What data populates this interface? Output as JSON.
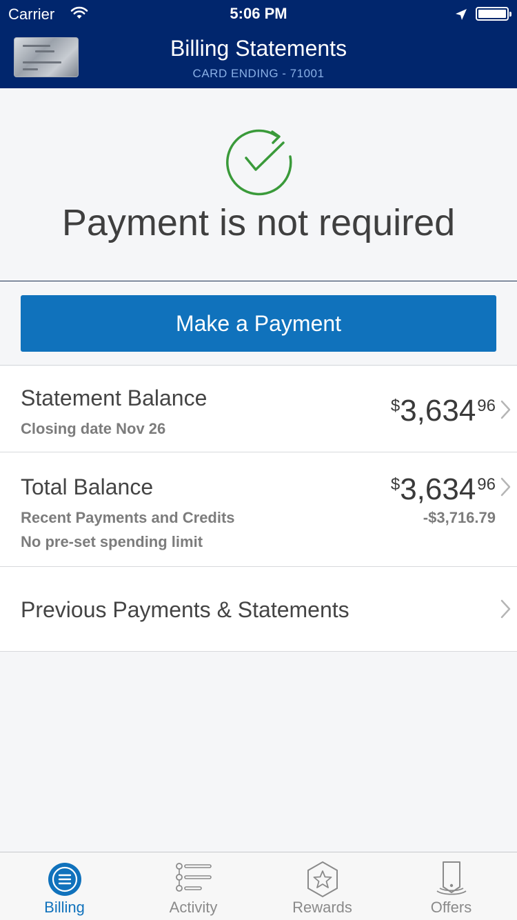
{
  "status_bar": {
    "carrier": "Carrier",
    "time": "5:06 PM"
  },
  "header": {
    "title": "Billing Statements",
    "subtitle": "CARD ENDING - 71001"
  },
  "hero": {
    "message": "Payment is not required"
  },
  "actions": {
    "make_payment": "Make a Payment"
  },
  "statement_balance": {
    "title": "Statement Balance",
    "subtitle": "Closing date Nov 26",
    "currency_symbol": "$",
    "amount_whole": "3,634",
    "amount_cents": "96"
  },
  "total_balance": {
    "title": "Total Balance",
    "line1": "Recent Payments and Credits",
    "line2": "No pre-set spending limit",
    "currency_symbol": "$",
    "amount_whole": "3,634",
    "amount_cents": "96",
    "credits": "-$3,716.79"
  },
  "history": {
    "title": "Previous Payments & Statements"
  },
  "tabbar": {
    "tabs": [
      {
        "label": "Billing",
        "active": true
      },
      {
        "label": "Activity",
        "active": false
      },
      {
        "label": "Rewards",
        "active": false
      },
      {
        "label": "Offers",
        "active": false
      }
    ]
  },
  "colors": {
    "header_bg": "#01266d",
    "accent": "#1072bc",
    "success": "#3a9a3a",
    "subtitle": "#8ab0e6"
  }
}
